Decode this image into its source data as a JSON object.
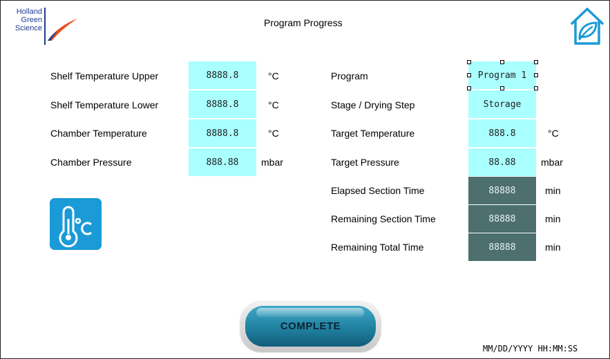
{
  "header": {
    "logo_lines": [
      "Holland",
      "Green",
      "Science"
    ],
    "title": "Program Progress",
    "home_icon": "home-leaf-icon"
  },
  "left_panel": {
    "rows": [
      {
        "label": "Shelf Temperature Upper",
        "value": "8888.8",
        "unit": "°C"
      },
      {
        "label": "Shelf Temperature Lower",
        "value": "8888.8",
        "unit": "°C"
      },
      {
        "label": "Chamber Temperature",
        "value": "8888.8",
        "unit": "°C"
      },
      {
        "label": "Chamber Pressure",
        "value": "888.88",
        "unit": "mbar"
      }
    ],
    "temp_icon": "thermometer-celsius-icon"
  },
  "right_panel": {
    "rows": [
      {
        "label": "Program",
        "value": "Program 1",
        "unit": ""
      },
      {
        "label": "Stage / Drying Step",
        "value": "Storage",
        "unit": ""
      },
      {
        "label": "Target Temperature",
        "value": "888.8",
        "unit": "°C"
      },
      {
        "label": "Target Pressure",
        "value": "88.88",
        "unit": "mbar"
      },
      {
        "label": "Elapsed Section Time",
        "value": "88888",
        "unit": "min"
      },
      {
        "label": "Remaining Section Time",
        "value": "88888",
        "unit": "min"
      },
      {
        "label": "Remaining Total Time",
        "value": "88888",
        "unit": "min"
      }
    ]
  },
  "actions": {
    "complete_label": "COMPLETE"
  },
  "footer": {
    "datetime": "MM/DD/YYYY HH:MM:SS"
  },
  "colors": {
    "value_box": "#aaffff",
    "time_box": "#4d6f6e",
    "accent_blue": "#1a9ad6",
    "logo_orange": "#e8501e"
  }
}
